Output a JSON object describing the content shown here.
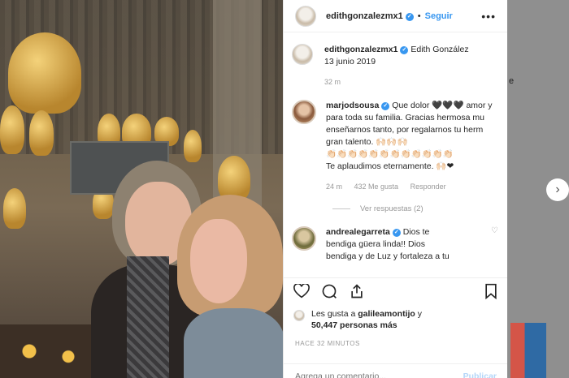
{
  "header": {
    "username": "edithgonzalezmx1",
    "separator": "•",
    "follow_label": "Seguir",
    "more_label": "•••"
  },
  "caption": {
    "username": "edithgonzalezmx1",
    "text": "Edith González",
    "date": "13 junio 2019",
    "age": "32 m"
  },
  "comments": [
    {
      "username": "marjodsousa",
      "lines": [
        "Que dolor 🖤🖤🖤 amor y",
        "para toda su familia. Gracias hermosa mu",
        "enseñarnos tanto, por regalarnos tu herm",
        "gran talento. 🙌🏻🙌🏻🙌🏻",
        "👏🏻👏🏻👏🏻👏🏻👏🏻👏🏻👏🏻👏🏻👏🏻👏🏻👏🏻👏🏻",
        "Te aplaudimos eternamente. 🙌🏻❤"
      ],
      "time": "24 m",
      "likes": "432 Me gusta",
      "reply": "Responder",
      "view_replies": "Ver respuestas (2)"
    },
    {
      "username": "andrealegarreta",
      "lines": [
        "Dios te",
        "bendiga güera linda!! Dios",
        "bendiga y de Luz y fortaleza a tu"
      ]
    }
  ],
  "likes": {
    "prefix": "Les gusta a",
    "user": "galileamontijo",
    "connector": "y",
    "count": "50,447 personas más"
  },
  "time_ago": "HACE 32 MINUTOS",
  "add_comment": {
    "placeholder": "Agrega un comentario...",
    "publish": "Publicar"
  },
  "backdrop": {
    "fragment": "e",
    "next": "›"
  },
  "icons": {
    "heart": "heart-icon",
    "comment": "comment-icon",
    "share": "share-icon",
    "save": "bookmark-icon",
    "verified": "verified-badge-icon"
  },
  "colors": {
    "link_blue": "#3897f0",
    "publish_disabled": "#b3d6f9",
    "verified": "#3897f0"
  }
}
